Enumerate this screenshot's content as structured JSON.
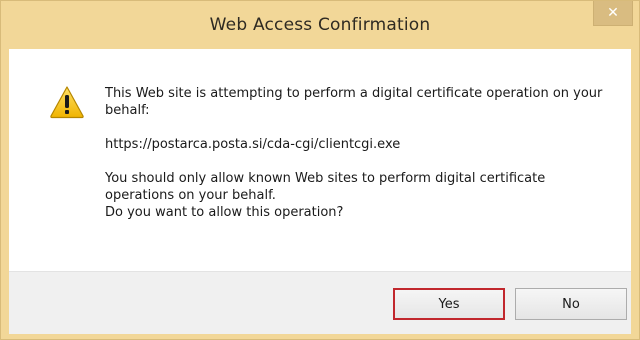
{
  "dialog": {
    "title": "Web Access Confirmation",
    "close_glyph": "✕",
    "message_line1": "This Web site is attempting to perform a digital certificate operation on your behalf:",
    "url": "https://postarca.posta.si/cda-cgi/clientcgi.exe",
    "warning_line1": "You should only allow known Web sites to perform digital certificate operations on your behalf.",
    "question": "Do you want to allow this operation?",
    "yes_label": "Yes",
    "no_label": "No"
  },
  "colors": {
    "frame": "#f2d798",
    "focus_border": "#c1272d",
    "warning_fill": "#f5c400"
  },
  "icons": {
    "warning": "warning-icon",
    "close": "close-icon"
  }
}
